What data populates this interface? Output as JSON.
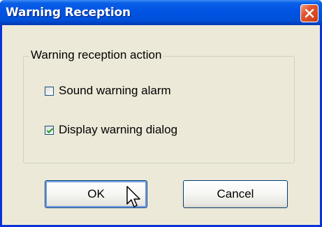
{
  "window": {
    "title": "Warning Reception"
  },
  "group": {
    "legend": "Warning reception action",
    "options": [
      {
        "label": "Sound warning alarm",
        "checked": false
      },
      {
        "label": "Display warning dialog",
        "checked": true
      }
    ]
  },
  "buttons": {
    "ok_label": "OK",
    "cancel_label": "Cancel"
  },
  "icons": {
    "close": "close-icon",
    "check": "checkmark-icon",
    "cursor": "mouse-pointer-icon"
  },
  "colors": {
    "titlebar": "#0054e3",
    "window_face": "#ece9d8",
    "close_button": "#e4562e"
  }
}
